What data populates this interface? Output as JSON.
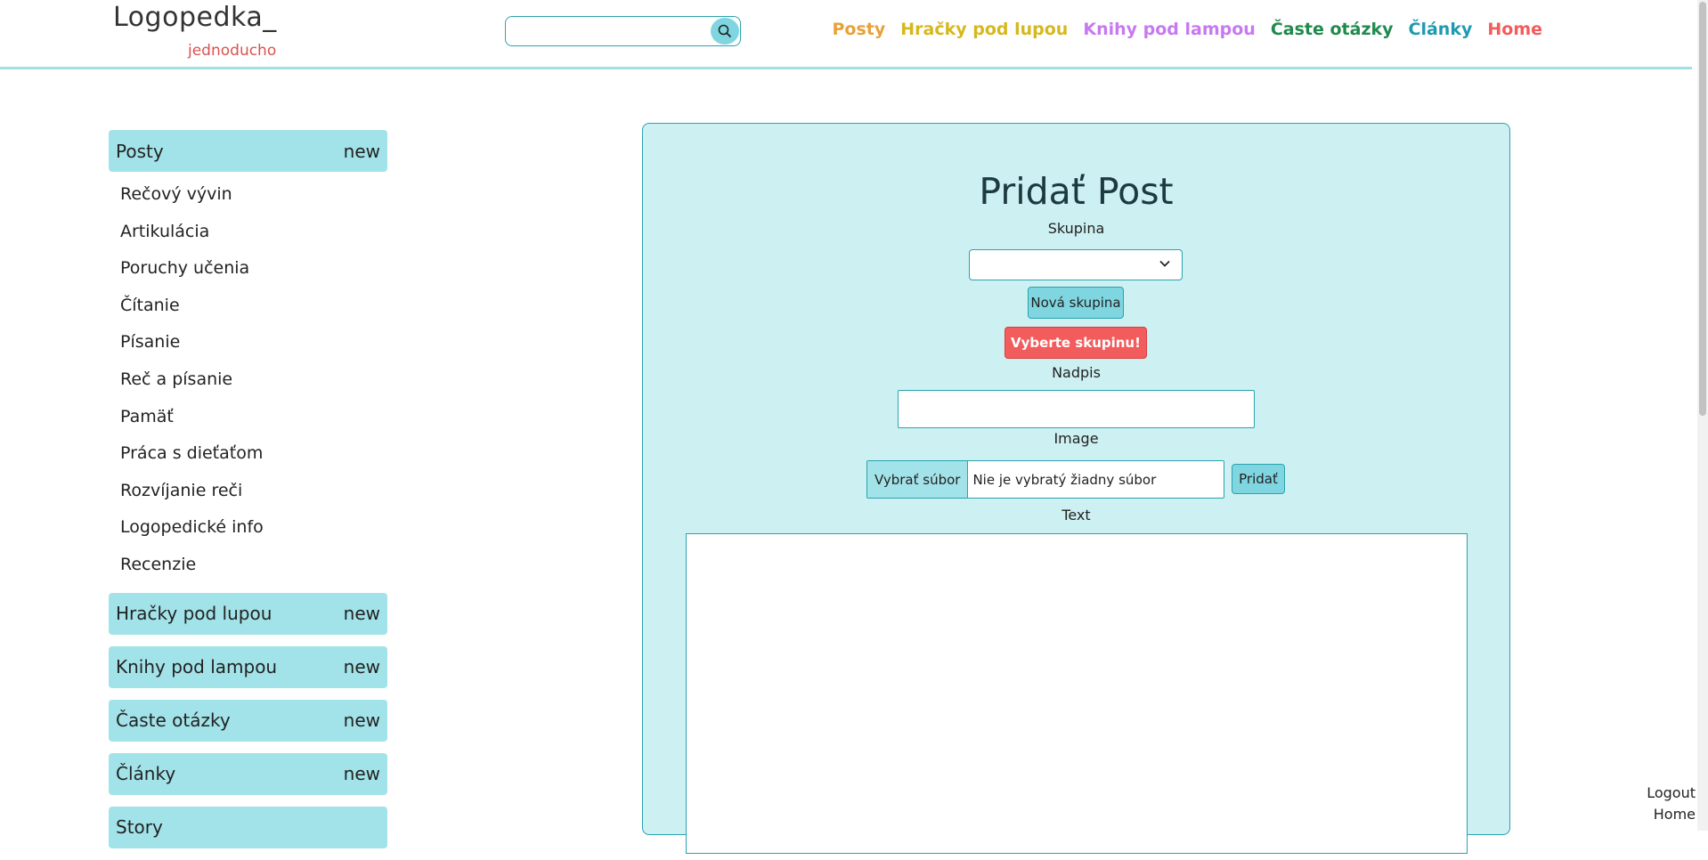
{
  "header": {
    "logo": "Logopedka_",
    "tagline": "jednoducho",
    "search_placeholder": "",
    "nav": [
      {
        "label": "Posty",
        "color": "#e8a13a"
      },
      {
        "label": "Hračky pod lupou",
        "color": "#d6b81e"
      },
      {
        "label": "Knihy pod lampou",
        "color": "#c679f0"
      },
      {
        "label": "Časte otázky",
        "color": "#1f8a4c"
      },
      {
        "label": "Články",
        "color": "#1e9ab0"
      },
      {
        "label": "Home",
        "color": "#f25c5c"
      }
    ]
  },
  "sidebar": {
    "posty": {
      "label": "Posty",
      "badge": "new"
    },
    "posty_items": [
      "Rečový vývin",
      "Artikulácia",
      "Poruchy učenia",
      "Čítanie",
      "Písanie",
      "Reč a písanie",
      "Pamäť",
      "Práca s dieťaťom",
      "Rozvíjanie reči",
      "Logopedické info",
      "Recenzie"
    ],
    "sections": [
      {
        "label": "Hračky pod lupou",
        "badge": "new"
      },
      {
        "label": "Knihy pod lampou",
        "badge": "new"
      },
      {
        "label": "Časte otázky",
        "badge": "new"
      },
      {
        "label": "Články",
        "badge": "new"
      },
      {
        "label": "Story",
        "badge": ""
      }
    ]
  },
  "form": {
    "title": "Pridať Post",
    "group_label": "Skupina",
    "group_value": "",
    "new_group_button": "Nová skupina",
    "error_button": "Vyberte skupinu!",
    "heading_label": "Nadpis",
    "heading_value": "",
    "image_label": "Image",
    "file_button": "Vybrať súbor",
    "file_status": "Nie je vybratý žiadny súbor",
    "add_button": "Pridať",
    "text_label": "Text",
    "text_value": ""
  },
  "footer": {
    "logout": "Logout",
    "home": "Home"
  }
}
